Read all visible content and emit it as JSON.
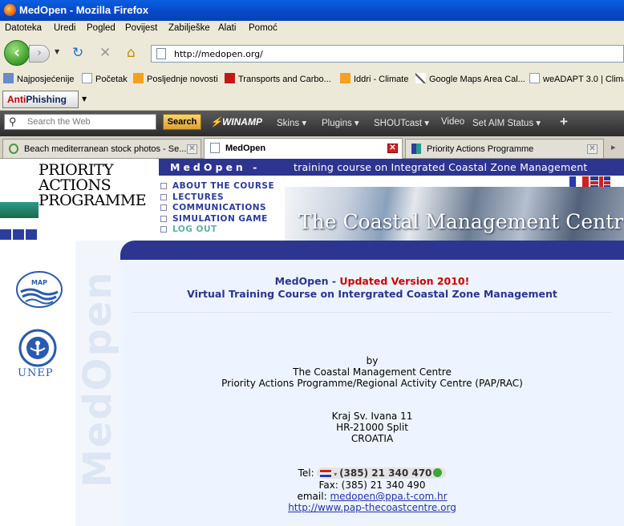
{
  "window": {
    "title": "MedOpen - Mozilla Firefox"
  },
  "menu": [
    "Datoteka",
    "Uredi",
    "Pogled",
    "Povijest",
    "Zabilješke",
    "Alati",
    "Pomoć"
  ],
  "nav": {
    "url": "http://medopen.org/"
  },
  "bookmarks": [
    "Najposjećenije",
    "Početak",
    "Posljednje novosti",
    "Transports and Carbo...",
    "Iddri - Climate",
    "Google Maps Area Cal...",
    "weADAPT 3.0 | Clima"
  ],
  "toolbar": {
    "antiphishing_a": "Anti",
    "antiphishing_b": "Phishing",
    "search_placeholder": "Search the Web",
    "search_button": "Search",
    "winamp": "WINAMP",
    "items": [
      "Skins",
      "Plugins",
      "SHOUTcast",
      "Video",
      "Set AIM Status"
    ]
  },
  "tabs": [
    {
      "label": "Beach mediterranean stock photos - Se...",
      "active": false
    },
    {
      "label": "MedOpen",
      "active": true
    },
    {
      "label": "Priority Actions Programme",
      "active": false
    }
  ],
  "site": {
    "logo_lines": [
      "PRIORITY",
      "ACTIONS",
      "PROGRAMME"
    ],
    "strip_brand": "MedOpen -",
    "strip_text": "training course on Integrated Coastal Zone Management",
    "menu": [
      "ABOUT THE COURSE",
      "LECTURES",
      "COMMUNICATIONS",
      "SIMULATION GAME",
      "LOG OUT"
    ],
    "banner_title": "The Coastal Management Centre",
    "watermark": "MedOpen",
    "map_label": "MAP",
    "unep_label": "UNEP",
    "heading_prefix": "MedOpen - ",
    "heading_highlight": "Updated Version 2010!",
    "subheading": "Virtual Training Course on Intergrated Coastal Zone Management",
    "by": "by",
    "org1": "The Coastal Management Centre",
    "org2": "Priority Actions Programme/Regional Activity Centre (PAP/RAC)",
    "addr1": "Kraj Sv. Ivana 11",
    "addr2": "HR-21000 Split",
    "addr3": "CROATIA",
    "tel_label": "Tel:",
    "tel": "(385) 21 340 470",
    "fax": "Fax: (385) 21 340 490",
    "email_label": "email:",
    "email": "medopen@ppa.t-com.hr",
    "website": "http://www.pap-thecoastcentre.org"
  },
  "colors": {
    "site_blue": "#2c3590",
    "highlight_red": "#d00000",
    "titlebar": "#0848c8"
  }
}
